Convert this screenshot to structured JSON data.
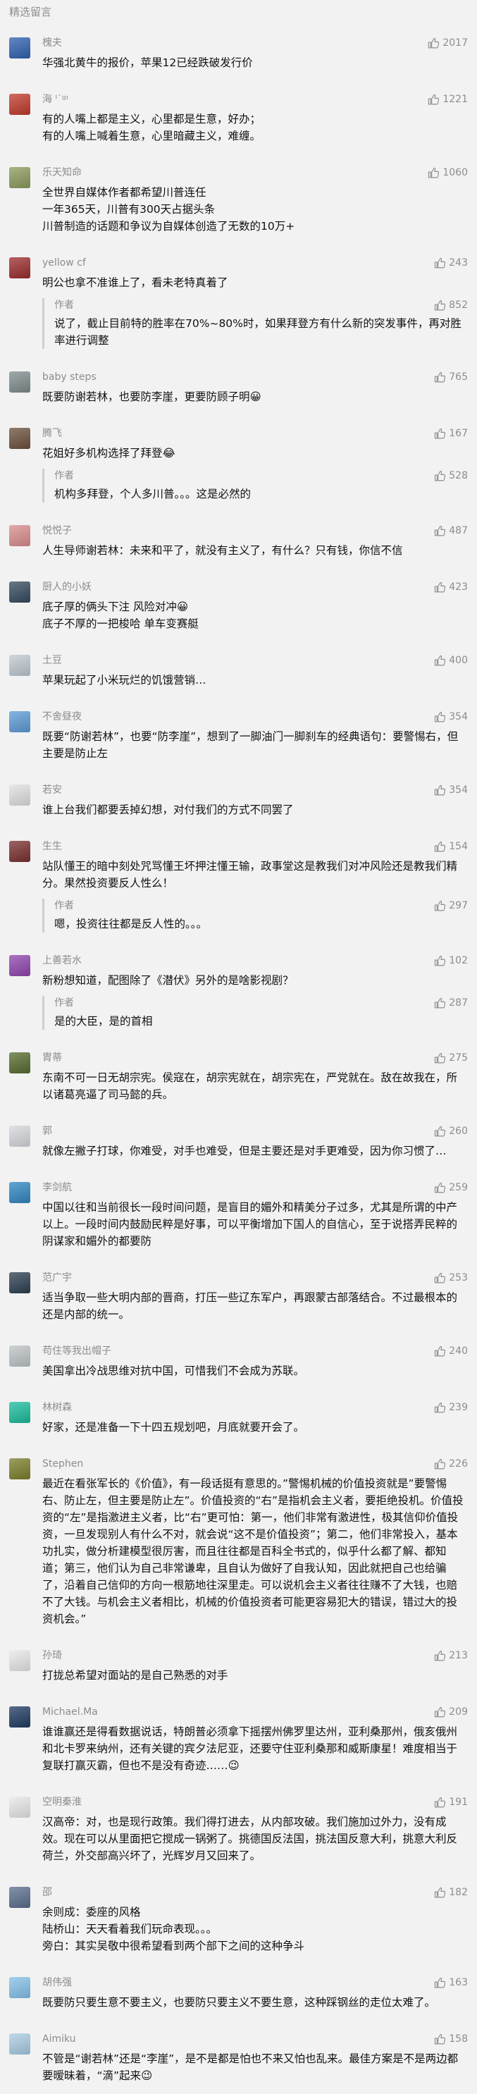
{
  "header": {
    "title": "精选留言"
  },
  "colors": {
    "meta": "#8c8c8c",
    "background": "#f2f2f2",
    "text": "#111111"
  },
  "comments": [
    {
      "nick": "槐夫",
      "likes": "2017",
      "avatar_color": "#2f5fb0",
      "avatar_icon": "landscape-avatar-icon",
      "text": "华强北黄牛的报价，苹果12已经跌破发行价"
    },
    {
      "nick": "海 ᴵ˙ᵍᶦ",
      "likes": "1221",
      "avatar_color": "#c0392b",
      "avatar_icon": "red-hat-avatar-icon",
      "text": "有的人嘴上都是主义，心里都是生意，好办；\n有的人嘴上喊着生意，心里暗藏主义，难缠。"
    },
    {
      "nick": "乐天知命",
      "likes": "1060",
      "avatar_color": "#8a9a5b",
      "avatar_icon": "cartoon-avatar-icon",
      "text": "全世界自媒体作者都希望川普连任\n一年365天，川普有300天占据头条\n川普制造的话题和争议为自媒体创造了无数的10万+"
    },
    {
      "nick": "yellow cf",
      "likes": "243",
      "avatar_color": "#9b2c2c",
      "avatar_icon": "portrait-avatar-icon",
      "text": "明公也拿不准谁上了，看未老特真着了",
      "reply": {
        "author": "作者",
        "likes": "852",
        "text": "说了，截止目前特的胜率在70%~80%时，如果拜登方有什么新的突发事件，再对胜率进行调整"
      }
    },
    {
      "nick": "baby steps",
      "likes": "765",
      "avatar_color": "#7f8c8d",
      "avatar_icon": "photo-avatar-icon",
      "text": "既要防谢若林，也要防李崖，更要防顾子明😀"
    },
    {
      "nick": "腾飞",
      "likes": "167",
      "avatar_color": "#6b4f3a",
      "avatar_icon": "portrait-avatar-icon",
      "text": "花姐好多机构选择了拜登😂",
      "reply": {
        "author": "作者",
        "likes": "528",
        "text": "机构多拜登，个人多川普。。。这是必然的"
      }
    },
    {
      "nick": "悦悦子",
      "likes": "487",
      "avatar_color": "#d98c8c",
      "avatar_icon": "flower-avatar-icon",
      "text": "人生导师谢若林：未来和平了，就没有主义了，有什么？只有钱，你信不信"
    },
    {
      "nick": "厨人的小妖",
      "likes": "423",
      "avatar_color": "#34495e",
      "avatar_icon": "dark-avatar-icon",
      "text": "底子厚的俩头下注 风险对冲😀\n底子不厚的一把梭哈 单车变赛艇"
    },
    {
      "nick": "土豆",
      "likes": "400",
      "avatar_color": "#bfc9d1",
      "avatar_icon": "cat-avatar-icon",
      "text": "苹果玩起了小米玩烂的饥饿营销…"
    },
    {
      "nick": "不舍昼夜",
      "likes": "354",
      "avatar_color": "#5d9bd5",
      "avatar_icon": "cartoon-avatar-icon",
      "text": "既要“防谢若林”，也要“防李崖”，想到了一脚油门一脚刹车的经典语句：要警惕右，但主要是防止左"
    },
    {
      "nick": "若安",
      "likes": "354",
      "avatar_color": "#e0e0e0",
      "avatar_icon": "default-avatar-icon",
      "text": "谁上台我们都要丢掉幻想，对付我们的方式不同罢了"
    },
    {
      "nick": "生生",
      "likes": "154",
      "avatar_color": "#7a2e2e",
      "avatar_icon": "portrait-avatar-icon",
      "text": "站队懂王的暗中刻处咒骂懂王坏押注懂王输，政事堂这是教我们对冲风险还是教我们精分。果然投资要反人性么！",
      "reply": {
        "author": "作者",
        "likes": "297",
        "text": "嗯，投资往往都是反人性的。。。"
      }
    },
    {
      "nick": "上善若水",
      "likes": "102",
      "avatar_color": "#8e44ad",
      "avatar_icon": "flower-avatar-icon",
      "text": "新粉想知道，配图除了《潜伏》另外的是啥影视剧？",
      "reply": {
        "author": "作者",
        "likes": "287",
        "text": "是的大臣，是的首相"
      }
    },
    {
      "nick": "胄蒂",
      "likes": "275",
      "avatar_color": "#556b2f",
      "avatar_icon": "photo-avatar-icon",
      "text": "东南不可一日无胡宗宪。侯寇在，胡宗宪就在，胡宗宪在，严党就在。敌在故我在，所以诸葛亮逼了司马懿的兵。"
    },
    {
      "nick": "郭",
      "likes": "260",
      "avatar_color": "#d5d8dc",
      "avatar_icon": "dog-avatar-icon",
      "text": "就像左撇子打球，你难受，对手也难受，但是主要还是对手更难受，因为你习惯了…"
    },
    {
      "nick": "李剑航",
      "likes": "259",
      "avatar_color": "#2e86c1",
      "avatar_icon": "sea-avatar-icon",
      "text": "中国以往和当前很长一段时间问题，是盲目的媚外和精美分子过多，尤其是所谓的中产以上。一段时间内鼓励民粹是好事，可以平衡增加下国人的自信心，至于说搭弄民粹的阴谋家和媚外的都要防"
    },
    {
      "nick": "范广宇",
      "likes": "253",
      "avatar_color": "#2c3e50",
      "avatar_icon": "portrait-avatar-icon",
      "text": "适当争取一些大明内部的晋商，打压一些辽东军户，再跟蒙古部落结合。不过最根本的还是内部的统一。"
    },
    {
      "nick": "苟住等我出帽子",
      "likes": "240",
      "avatar_color": "#bdc3c7",
      "avatar_icon": "cartoon-avatar-icon",
      "text": "美国拿出冷战思维对抗中国，可惜我们不会成为苏联。"
    },
    {
      "nick": "林树森",
      "likes": "239",
      "avatar_color": "#1abc9c",
      "avatar_icon": "cartoon-avatar-icon",
      "text": "好家，还是准备一下十四五规划吧，月底就要开会了。"
    },
    {
      "nick": "Stephen",
      "likes": "226",
      "avatar_color": "#7b7d2a",
      "avatar_icon": "photo-avatar-icon",
      "text": "最近在看张军长的《价值》，有一段话挺有意思的。”警惕机械的价值投资就是”要警惕右、防止左，但主要是防止左”。价值投资的“右”是指机会主义者，要拒绝投机。价值投资的“左”是指激进主义者，比“右”更可怕：第一，他们非常有激进性，极其信仰价值投资，一旦发现别人有什么不对，就会说“这不是价值投资”；第二，他们非常投入，基本功扎实，做分析建模型很厉害，而且往往都是百科全书式的，似乎什么都了解、都知道；第三，他们认为自己非常谦卑，且自认为做好了自我认知，因此就把自己也给骗了，沿着自己信仰的方向一根筋地往深里走。可以说机会主义者往往赚不了大钱，也赔不了大钱。与机会主义者相比，机械的价值投资者可能更容易犯大的错误，错过大的投资机会。”"
    },
    {
      "nick": "孙琦",
      "likes": "213",
      "avatar_color": "#e8e8e8",
      "avatar_icon": "default-avatar-icon",
      "text": "打拢总希望对面站的是自己熟悉的对手"
    },
    {
      "nick": "Michael.Ma",
      "likes": "209",
      "avatar_color": "#1f3a60",
      "avatar_icon": "portrait-avatar-icon",
      "text": "谁谁赢还是得看数据说话，特朗普必须拿下摇摆州佛罗里达州，亚利桑那州，俄亥俄州和北卡罗来纳州，还有关键的宾夕法尼亚，还要守住亚利桑那和威斯康星！难度相当于复联打赢灭霸，但也不是没有奇迹……😉"
    },
    {
      "nick": "空明秦淮",
      "likes": "191",
      "avatar_color": "#e8e8e8",
      "avatar_icon": "default-avatar-icon",
      "text": "汉高帝：对，也是现行政策。我们得打进去，从内部攻破。我们施加过外力，没有成效。现在可以从里面把它搅成一锅粥了。挑德国反法国，挑法国反意大利，挑意大利反荷兰，外交部高兴坏了，光辉岁月又回来了。"
    },
    {
      "nick": "邵",
      "likes": "182",
      "avatar_color": "#5a6e8c",
      "avatar_icon": "photo-avatar-icon",
      "text": "余则成：委座的风格\n陆桥山：天天看着我们玩命表现。。。\n旁白：其实吴敬中很希望看到两个部下之间的这种争斗"
    },
    {
      "nick": "胡伟强",
      "likes": "163",
      "avatar_color": "#85c1e9",
      "avatar_icon": "sea-avatar-icon",
      "text": "既要防只要生意不要主义，也要防只要主义不要生意，这种踩钢丝的走位太难了。"
    },
    {
      "nick": "Aimiku",
      "likes": "158",
      "avatar_color": "#a9cce3",
      "avatar_icon": "cartoon-avatar-icon",
      "text": "不管是“谢若林”还是“李崖”，是不是都是怕也不来又怕也乱来。最佳方案是不是两边都要暧昧着，“滴”起来😉"
    }
  ]
}
